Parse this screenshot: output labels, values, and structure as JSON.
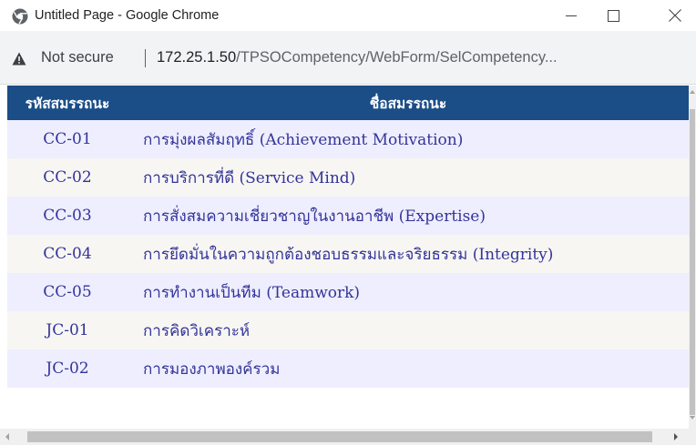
{
  "window": {
    "title": "Untitled Page - Google Chrome",
    "icon": "chrome-globe-icon"
  },
  "addressbar": {
    "security_label": "Not secure",
    "url_host": "172.25.1.50",
    "url_path": "/TPSOCompetency/WebForm/SelCompetency..."
  },
  "table": {
    "header_color": "#1b4d86",
    "headers": {
      "code": "รหัสสมรรถนะ",
      "name": "ชื่อสมรรถนะ"
    },
    "rows": [
      {
        "code": "CC-01",
        "name": "การมุ่งผลสัมฤทธิ์ (Achievement Motivation)"
      },
      {
        "code": "CC-02",
        "name": "การบริการที่ดี (Service Mind)"
      },
      {
        "code": "CC-03",
        "name": "การสั่งสมความเชี่ยวชาญในงานอาชีพ (Expertise)"
      },
      {
        "code": "CC-04",
        "name": "การยึดมั่นในความถูกต้องชอบธรรมและจริยธรรม (Integrity)"
      },
      {
        "code": "CC-05",
        "name": "การทำงานเป็นทีม (Teamwork)"
      },
      {
        "code": "JC-01",
        "name": "การคิดวิเคราะห์"
      },
      {
        "code": "JC-02",
        "name": "การมองภาพองค์รวม"
      }
    ]
  }
}
